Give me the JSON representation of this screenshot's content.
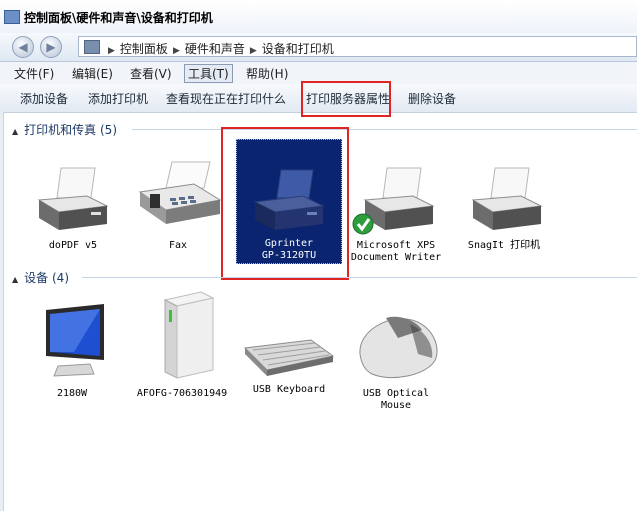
{
  "window": {
    "title": "控制面板\\硬件和声音\\设备和打印机"
  },
  "address": {
    "crumbs": [
      "控制面板",
      "硬件和声音",
      "设备和打印机"
    ]
  },
  "menu": [
    {
      "label": "文件(F)"
    },
    {
      "label": "编辑(E)"
    },
    {
      "label": "查看(V)"
    },
    {
      "label": "工具(T)"
    },
    {
      "label": "帮助(H)"
    }
  ],
  "toolbar": {
    "add_device": "添加设备",
    "add_printer": "添加打印机",
    "see_printing": "查看现在正在打印什么",
    "print_server_props": "打印服务器属性",
    "remove_device": "删除设备"
  },
  "groups": {
    "printers": {
      "title": "打印机和传真",
      "count": "(5)"
    },
    "devices": {
      "title": "设备",
      "count": "(4)"
    }
  },
  "printers": [
    {
      "line1": "doPDF v5",
      "line2": ""
    },
    {
      "line1": "Fax",
      "line2": ""
    },
    {
      "line1": "Gprinter",
      "line2": "GP-3120TU"
    },
    {
      "line1": "Microsoft XPS",
      "line2": "Document Writer"
    },
    {
      "line1": "SnagIt 打印机",
      "line2": ""
    }
  ],
  "devices": [
    {
      "line1": "2180W",
      "line2": ""
    },
    {
      "line1": "AFOFG-706301949",
      "line2": ""
    },
    {
      "line1": "USB Keyboard",
      "line2": ""
    },
    {
      "line1": "USB Optical",
      "line2": "Mouse"
    }
  ],
  "colors": {
    "highlight": "#e02424",
    "selection": "#0a2470",
    "accent_green": "#18a35a"
  }
}
